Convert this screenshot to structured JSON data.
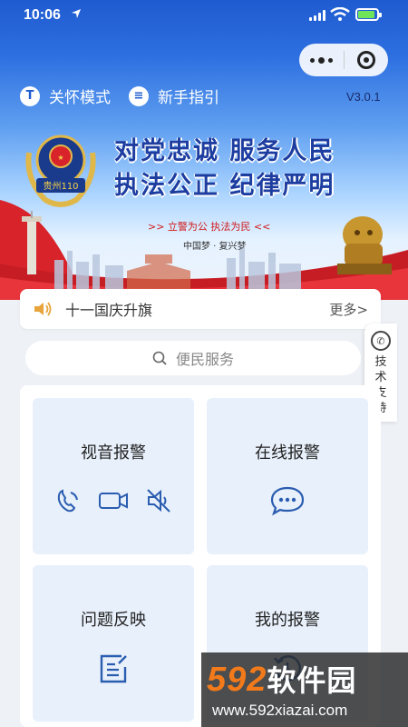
{
  "status_bar": {
    "time": "10:06"
  },
  "header": {
    "care_mode_label": "关怀模式",
    "guide_label": "新手指引",
    "version": "V3.0.1"
  },
  "banner": {
    "slogan_line1": "对党忠诚 服务人民",
    "slogan_line2": "执法公正 纪律严明",
    "subslogan": ">> 立警为公 执法为民 <<",
    "dream_text": "中国梦 · 复兴梦",
    "emblem_text": "贵州110"
  },
  "notice": {
    "text": "十一国庆升旗",
    "more_label": "更多>"
  },
  "side_tab": {
    "label": "技术支持"
  },
  "search": {
    "placeholder": "便民服务"
  },
  "tiles": [
    {
      "title": "视音报警",
      "icons": [
        "phone-call-icon",
        "video-camera-icon",
        "mute-icon"
      ]
    },
    {
      "title": "在线报警",
      "icons": [
        "chat-bubble-icon"
      ]
    },
    {
      "title": "问题反映",
      "icons": [
        "edit-document-icon"
      ]
    },
    {
      "title": "我的报警",
      "icons": [
        "history-icon"
      ]
    }
  ],
  "watermark": {
    "logo_number": "592",
    "logo_text": "软件园",
    "url": "www.592xiazai.com"
  },
  "colors": {
    "primary_blue": "#1f5bd0",
    "tile_bg": "#e8f0fb",
    "icon_blue": "#2a5db0",
    "slogan_blue": "#1d3da0",
    "accent_red": "#d01a1a",
    "watermark_orange": "#f27a1a"
  }
}
